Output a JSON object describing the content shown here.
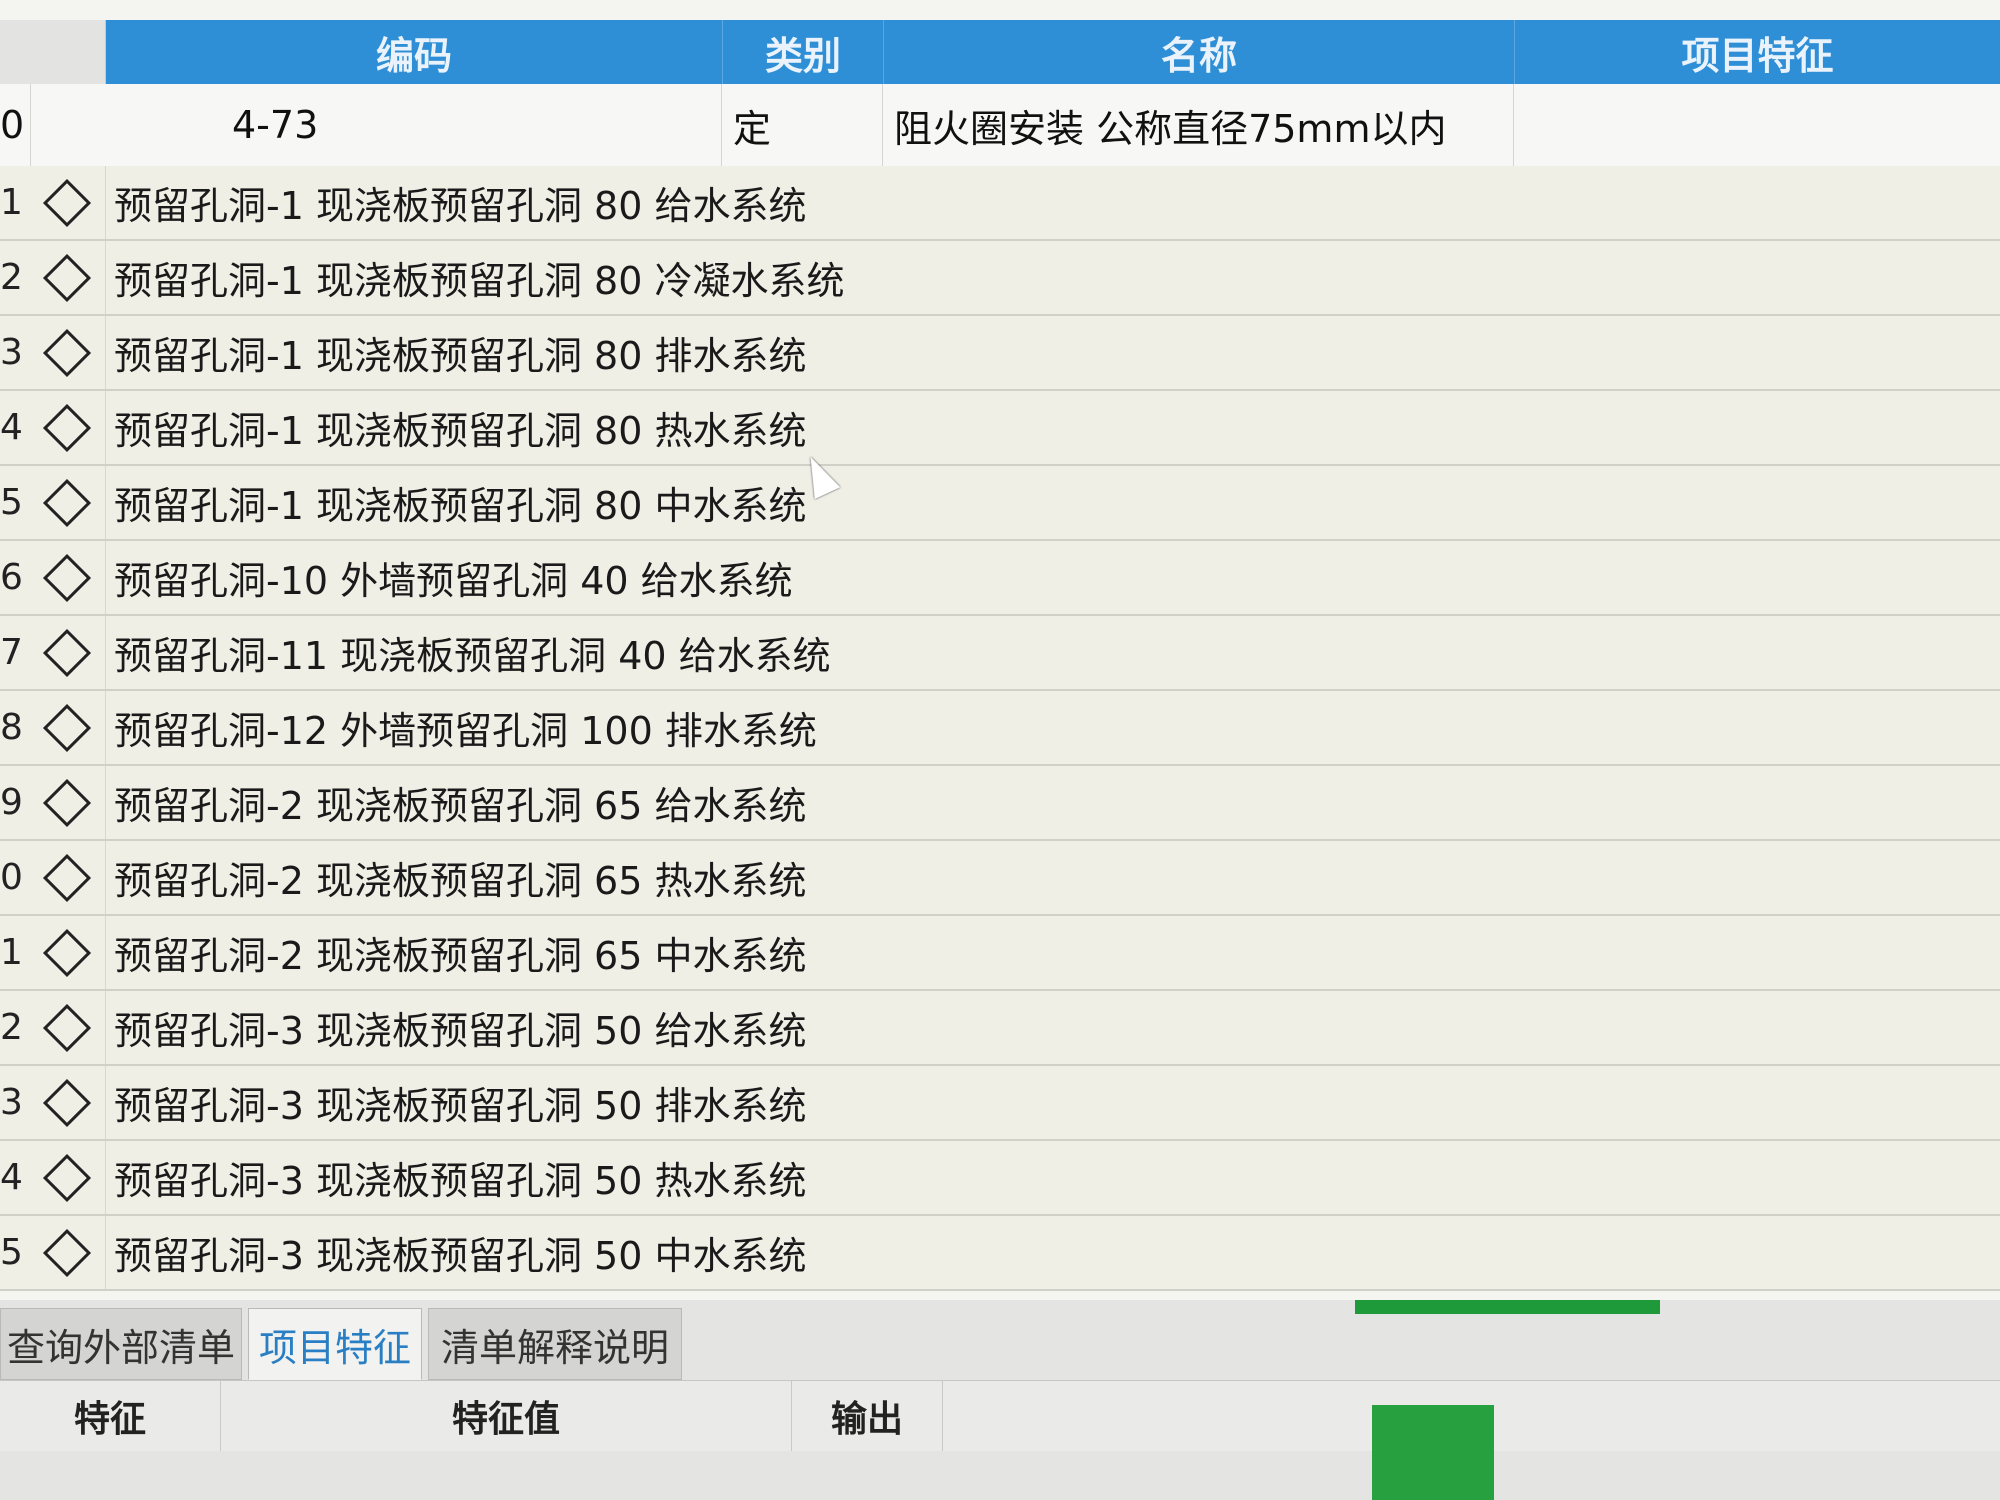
{
  "columns": [
    "编码",
    "类别",
    "名称",
    "项目特征"
  ],
  "selected_row": {
    "row_number": "0",
    "code": "4-73",
    "type": "定",
    "name": "阻火圈安装 公称直径75mm以内"
  },
  "rows": [
    {
      "num": "1",
      "name": "预留孔洞-1 现浇板预留孔洞 80 给水系统"
    },
    {
      "num": "2",
      "name": "预留孔洞-1 现浇板预留孔洞 80 冷凝水系统"
    },
    {
      "num": "3",
      "name": "预留孔洞-1 现浇板预留孔洞 80 排水系统"
    },
    {
      "num": "4",
      "name": "预留孔洞-1 现浇板预留孔洞 80 热水系统"
    },
    {
      "num": "5",
      "name": "预留孔洞-1 现浇板预留孔洞 80 中水系统"
    },
    {
      "num": "6",
      "name": "预留孔洞-10 外墙预留孔洞 40 给水系统"
    },
    {
      "num": "7",
      "name": "预留孔洞-11 现浇板预留孔洞 40 给水系统"
    },
    {
      "num": "8",
      "name": "预留孔洞-12 外墙预留孔洞 100 排水系统"
    },
    {
      "num": "9",
      "name": "预留孔洞-2 现浇板预留孔洞 65 给水系统"
    },
    {
      "num": "0",
      "name": "预留孔洞-2 现浇板预留孔洞 65 热水系统"
    },
    {
      "num": "1",
      "name": "预留孔洞-2 现浇板预留孔洞 65 中水系统"
    },
    {
      "num": "2",
      "name": "预留孔洞-3 现浇板预留孔洞 50 给水系统"
    },
    {
      "num": "3",
      "name": "预留孔洞-3 现浇板预留孔洞 50 排水系统"
    },
    {
      "num": "4",
      "name": "预留孔洞-3 现浇板预留孔洞 50 热水系统"
    },
    {
      "num": "5",
      "name": "预留孔洞-3 现浇板预留孔洞 50 中水系统"
    }
  ],
  "tabs": [
    "查询外部清单",
    "项目特征",
    "清单解释说明"
  ],
  "active_tab": "项目特征",
  "feature_table_headers": [
    "特征",
    "特征值",
    "输出"
  ],
  "colors": {
    "header_blue": "#2f8fd6",
    "row_bg": "#efefe6",
    "accent_green": "#1f9a3a",
    "active_tab_text": "#2a7fc4"
  },
  "icons": {
    "row_marker": "diamond-icon",
    "mouse_pointer": "cursor-icon"
  }
}
